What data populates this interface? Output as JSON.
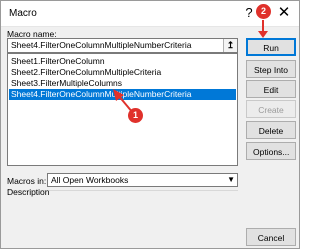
{
  "window": {
    "title": "Macro",
    "help_glyph": "?",
    "close_glyph": "✕"
  },
  "form": {
    "macro_name_label": "Macro name:",
    "macro_name_value": "Sheet4.FilterOneColumnMultipleNumberCriteria",
    "upload_glyph": "↥",
    "macros": [
      "Sheet1.FilterOneColumn",
      "Sheet2.FilterOneColumnMultipleCriteria",
      "Sheet3.FilterMultipleColumns",
      "Sheet4.FilterOneColumnMultipleNumberCriteria"
    ],
    "selected_index": 3,
    "macros_in_label": "Macros in:",
    "macros_in_value": "All Open Workbooks",
    "description_label": "Description"
  },
  "buttons": {
    "run": "Run",
    "step_into": "Step Into",
    "edit": "Edit",
    "create": "Create",
    "delete": "Delete",
    "options": "Options...",
    "cancel": "Cancel"
  },
  "annotations": {
    "step1": "1",
    "step2": "2",
    "color": "#e0312b"
  },
  "colors": {
    "selection": "#0078d7",
    "dialog_bg": "#f0f0f0"
  }
}
